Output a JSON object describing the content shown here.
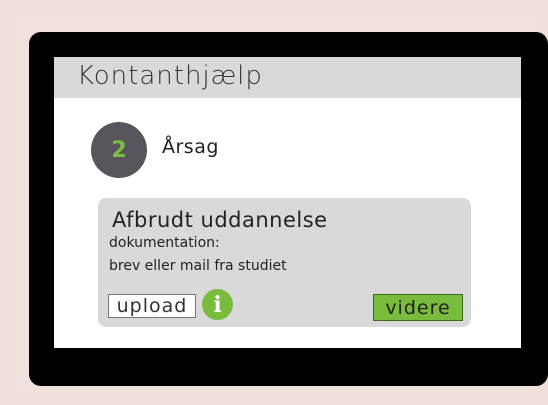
{
  "app": {
    "title": "Kontanthjælp"
  },
  "step": {
    "number": "2",
    "label": "Årsag"
  },
  "card": {
    "title": "Afbrudt uddannelse",
    "line1": "dokumentation:",
    "line2": "brev eller mail fra studiet",
    "upload_label": "upload",
    "info_icon": "i",
    "next_label": "videre"
  },
  "colors": {
    "background": "#efdfd9",
    "device": "#000000",
    "screen": "#ffffff",
    "titlebar": "#d9d9d9",
    "step_circle": "#58555c",
    "accent_green": "#78bb3d"
  }
}
